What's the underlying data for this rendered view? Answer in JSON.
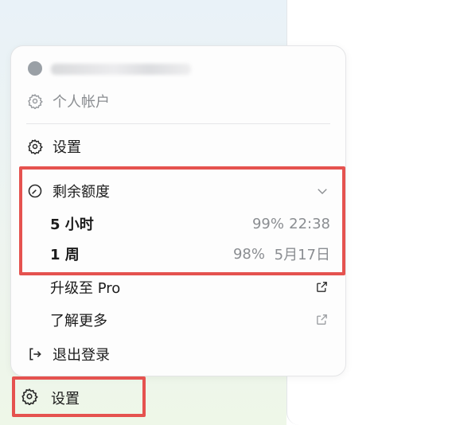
{
  "menu": {
    "account_label": "个人帐户",
    "settings_label": "设置",
    "quota": {
      "title": "剩余额度",
      "rows": [
        {
          "label": "5 小时",
          "percent": "99%",
          "time": "22:38"
        },
        {
          "label": "1 周",
          "percent": "98%",
          "time": "5月17日"
        }
      ]
    },
    "upgrade_label": "升级至 Pro",
    "learn_more_label": "了解更多",
    "logout_label": "退出登录"
  },
  "sidebar": {
    "settings_label": "设置"
  },
  "colors": {
    "highlight": "#e5524f",
    "muted_text": "#8a8d91"
  }
}
